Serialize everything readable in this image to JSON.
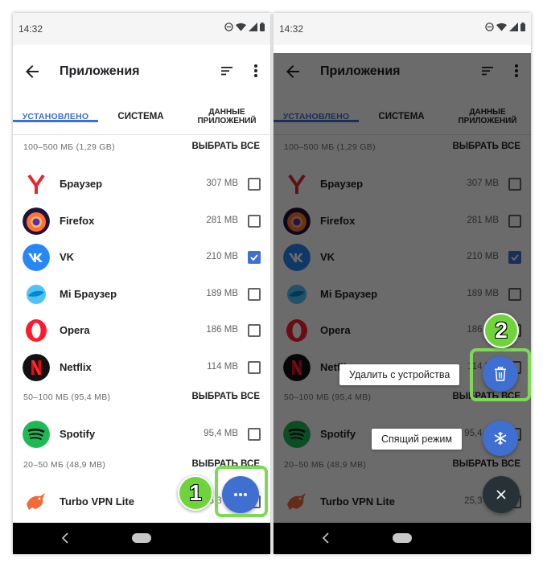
{
  "status_bar": {
    "time": "14:32"
  },
  "app_bar": {
    "title": "Приложения",
    "back_icon": "arrow-back-icon",
    "sort_icon": "sort-icon",
    "menu_icon": "more-vert-icon"
  },
  "tabs": [
    {
      "label": "УСТАНОВЛЕНО",
      "active": true
    },
    {
      "label": "СИСТЕМА",
      "active": false
    },
    {
      "label_line1": "ДАННЫЕ",
      "label_line2": "ПРИЛОЖЕНИЙ",
      "active": false
    }
  ],
  "sections": [
    {
      "title": "100–500 МБ (1,29 GB)",
      "select_all": "ВЫБРАТЬ ВСЕ",
      "apps": [
        {
          "name": "Браузер",
          "size": "307 MB",
          "checked": false,
          "icon": "yandex-browser-icon"
        },
        {
          "name": "Firefox",
          "size": "281 MB",
          "checked": false,
          "icon": "firefox-icon"
        },
        {
          "name": "VK",
          "size": "210 MB",
          "checked": true,
          "icon": "vk-icon"
        },
        {
          "name": "Mi Браузер",
          "size": "189 MB",
          "checked": false,
          "icon": "mi-browser-icon"
        },
        {
          "name": "Opera",
          "size": "186 MB",
          "checked": false,
          "icon": "opera-icon"
        },
        {
          "name": "Netflix",
          "size": "114 MB",
          "checked": false,
          "icon": "netflix-icon"
        }
      ]
    },
    {
      "title": "50–100 МБ (95,4 MB)",
      "select_all": "ВЫБРАТЬ ВСЕ",
      "apps": [
        {
          "name": "Spotify",
          "size": "95,4 MB",
          "checked": false,
          "icon": "spotify-icon"
        }
      ]
    },
    {
      "title": "20–50 МБ (48,9 MB)",
      "select_all": "ВЫБРАТЬ ВСЕ",
      "apps": [
        {
          "name": "Turbo VPN Lite",
          "size": "25,3 MB",
          "checked": false,
          "icon": "turbo-vpn-icon"
        }
      ]
    }
  ],
  "fab_menu": {
    "delete_label": "Удалить с устройства",
    "sleep_label": "Спящий режим"
  },
  "step_badges": {
    "step1": "1",
    "step2": "2"
  },
  "colors": {
    "accent": "#3f6fd1",
    "highlight": "#7ed957",
    "badge": "#6fd43c"
  }
}
